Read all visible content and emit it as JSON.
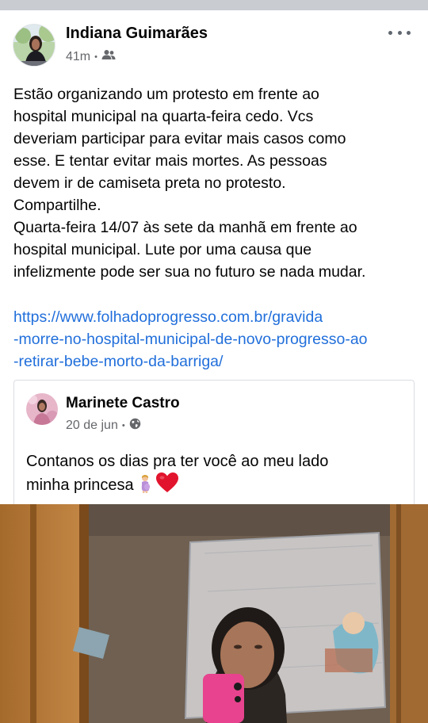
{
  "post": {
    "author": "Indiana Guimarães",
    "time": "41m",
    "separator": "•",
    "audience_icon": "friends-icon",
    "more_icon": "more-options-icon",
    "text_lines": [
      "Estão organizando um protesto em frente ao",
      "hospital municipal na quarta-feira cedo. Vcs",
      "deveriam participar para evitar mais casos como",
      "esse. E tentar evitar mais mortes. As pessoas",
      "devem ir de camiseta preta no protesto.",
      "Compartilhe.",
      "Quarta-feira 14/07 às sete da manhã em frente ao",
      "hospital municipal. Lute por uma causa que",
      "infelizmente pode ser sua no futuro se nada mudar."
    ],
    "link_lines": [
      "https://www.folhadoprogresso.com.br/gravida",
      "-morre-no-hospital-municipal-de-novo-progresso-ao",
      "-retirar-bebe-morto-da-barriga/"
    ]
  },
  "shared": {
    "author": "Marinete Castro",
    "date": "20 de jun",
    "separator": "•",
    "audience_icon": "globe-icon",
    "text_lines": [
      "Contanos os dias pra ter você ao meu lado",
      "minha princesa"
    ],
    "emojis": [
      "pregnant-woman-emoji",
      "red-heart-emoji"
    ]
  },
  "colors": {
    "link": "#216fdb",
    "secondary_text": "#65676b",
    "divider": "#c9ccd1"
  }
}
